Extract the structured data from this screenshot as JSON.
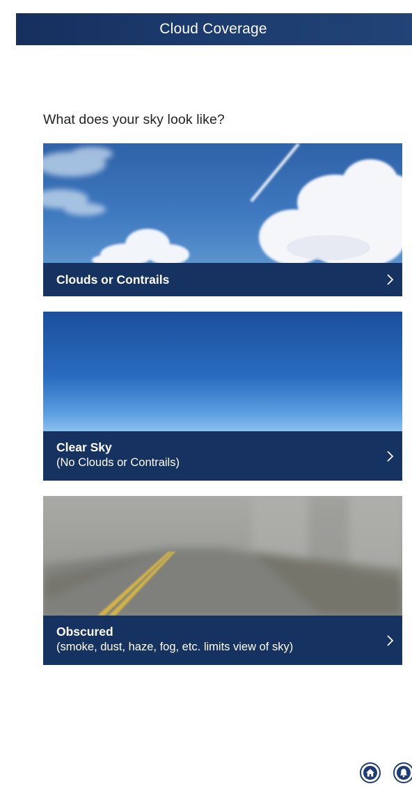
{
  "header": {
    "title": "Cloud Coverage"
  },
  "prompt": "What does your sky look like?",
  "options": [
    {
      "title": "Clouds or Contrails",
      "subtitle": ""
    },
    {
      "title": "Clear Sky",
      "subtitle": "(No Clouds or Contrails)"
    },
    {
      "title": "Obscured",
      "subtitle": "(smoke, dust, haze, fog, etc. limits view of sky)"
    }
  ],
  "colors": {
    "header_bg": "#1a3668",
    "card_bar_bg": "#163260",
    "accent": "#1f3d74"
  },
  "icons": [
    "chevron-right-icon",
    "home-icon",
    "bell-icon"
  ]
}
